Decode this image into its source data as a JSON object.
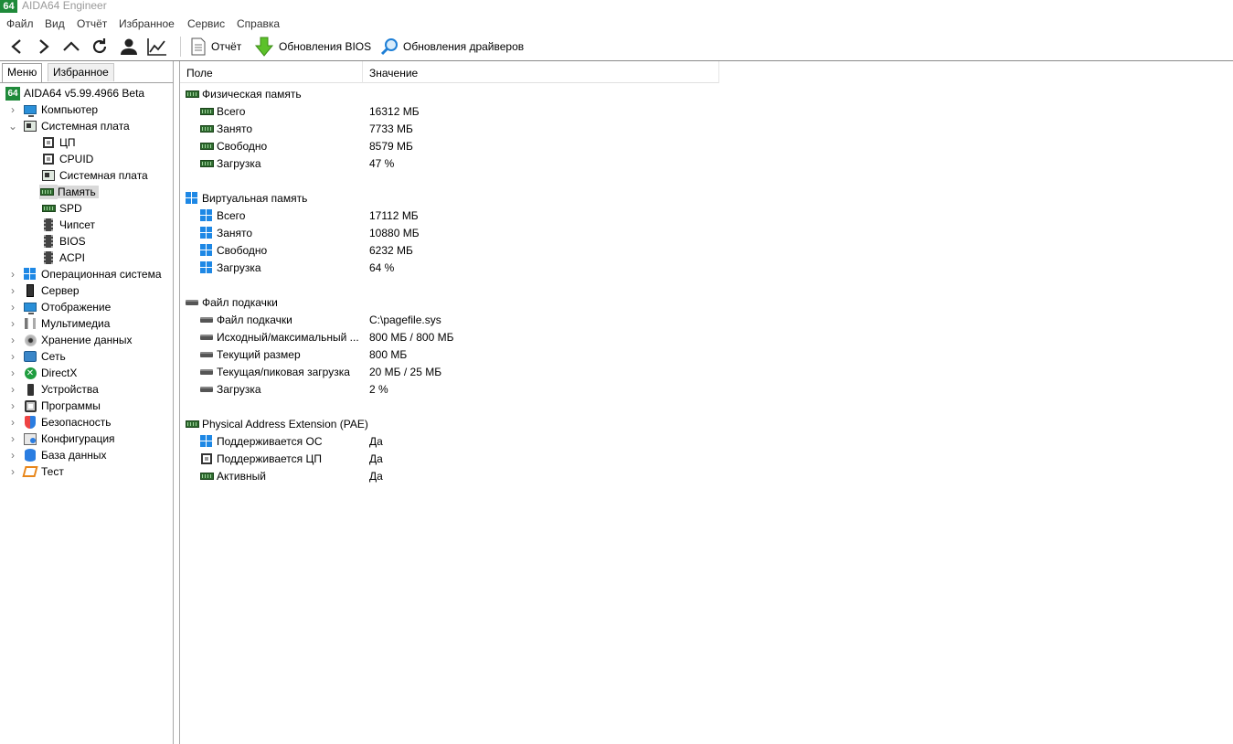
{
  "window": {
    "title": "AIDA64 Engineer",
    "logo_text": "64"
  },
  "menubar": [
    "Файл",
    "Вид",
    "Отчёт",
    "Избранное",
    "Сервис",
    "Справка"
  ],
  "toolbar": {
    "report_label": "Отчёт",
    "bios_update_label": "Обновления BIOS",
    "driver_update_label": "Обновления драйверов"
  },
  "tabs": {
    "menu": "Меню",
    "favorites": "Избранное"
  },
  "tree": {
    "root": "AIDA64 v5.99.4966 Beta",
    "computer": "Компьютер",
    "motherboard": "Системная плата",
    "children": [
      "ЦП",
      "CPUID",
      "Системная плата",
      "Память",
      "SPD",
      "Чипсет",
      "BIOS",
      "ACPI"
    ],
    "rest": [
      "Операционная система",
      "Сервер",
      "Отображение",
      "Мультимедиа",
      "Хранение данных",
      "Сеть",
      "DirectX",
      "Устройства",
      "Программы",
      "Безопасность",
      "Конфигурация",
      "База данных",
      "Тест"
    ]
  },
  "columns": {
    "field": "Поле",
    "value": "Значение"
  },
  "sections": {
    "physical": {
      "title": "Физическая память",
      "rows": [
        {
          "field": "Всего",
          "value": "16312 МБ"
        },
        {
          "field": "Занято",
          "value": "7733 МБ"
        },
        {
          "field": "Свободно",
          "value": "8579 МБ"
        },
        {
          "field": "Загрузка",
          "value": "47 %"
        }
      ]
    },
    "virtual": {
      "title": "Виртуальная память",
      "rows": [
        {
          "field": "Всего",
          "value": "17112 МБ"
        },
        {
          "field": "Занято",
          "value": "10880 МБ"
        },
        {
          "field": "Свободно",
          "value": "6232 МБ"
        },
        {
          "field": "Загрузка",
          "value": "64 %"
        }
      ]
    },
    "pagefile": {
      "title": "Файл подкачки",
      "rows": [
        {
          "field": "Файл подкачки",
          "value": "C:\\pagefile.sys"
        },
        {
          "field": "Исходный/максимальный ...",
          "value": "800 МБ / 800 МБ"
        },
        {
          "field": "Текущий размер",
          "value": "800 МБ"
        },
        {
          "field": "Текущая/пиковая загрузка",
          "value": "20 МБ / 25 МБ"
        },
        {
          "field": "Загрузка",
          "value": "2 %"
        }
      ]
    },
    "pae": {
      "title": "Physical Address Extension (PAE)",
      "rows": [
        {
          "field": "Поддерживается ОС",
          "value": "Да"
        },
        {
          "field": "Поддерживается ЦП",
          "value": "Да"
        },
        {
          "field": "Активный",
          "value": "Да"
        }
      ]
    }
  }
}
